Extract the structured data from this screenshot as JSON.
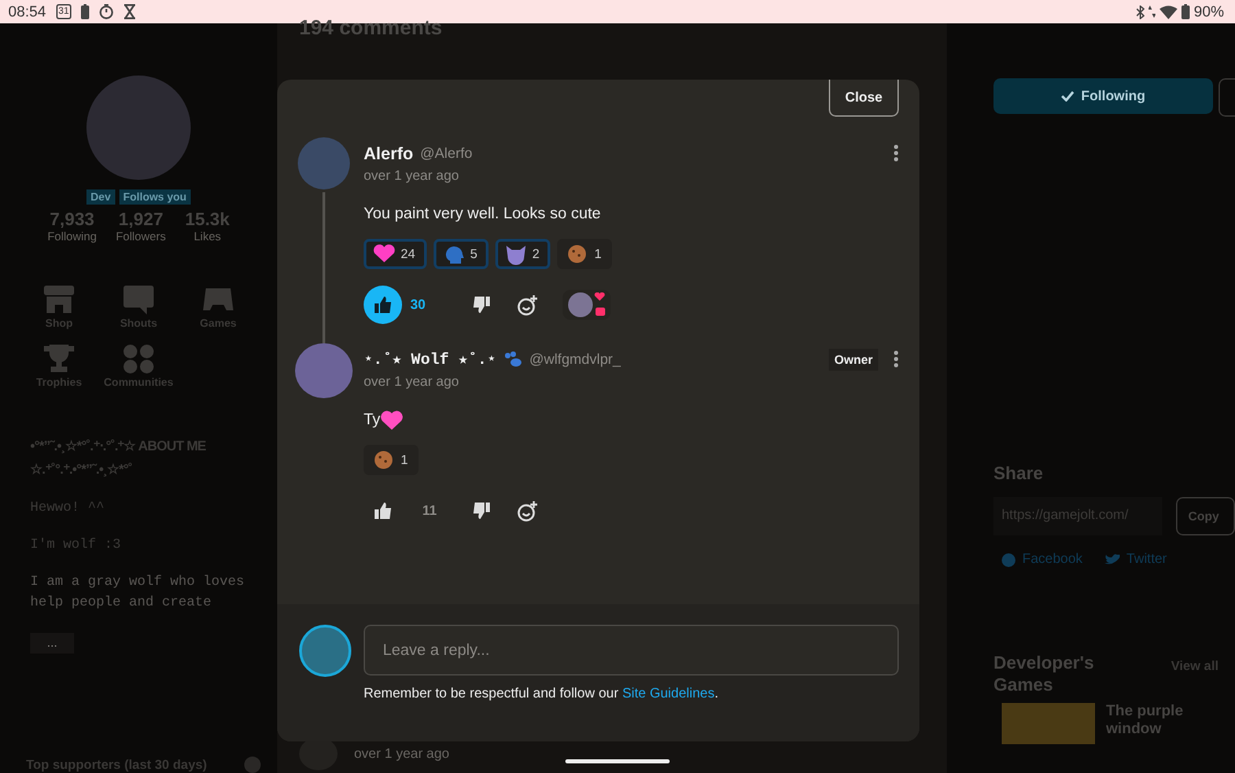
{
  "status_bar": {
    "time": "08:54",
    "calendar_day": "31",
    "battery": "90%"
  },
  "profile": {
    "badges": [
      "Dev",
      "Follows you"
    ],
    "stats": [
      {
        "value": "7,933",
        "label": "Following"
      },
      {
        "value": "1,927",
        "label": "Followers"
      },
      {
        "value": "15.3k",
        "label": "Likes"
      }
    ],
    "nav": [
      {
        "label": "Shop",
        "kind": "shop"
      },
      {
        "label": "Shouts",
        "kind": "shouts"
      },
      {
        "label": "Games",
        "kind": "games"
      },
      {
        "label": "Trophies",
        "kind": "trophies"
      },
      {
        "label": "Communities",
        "kind": "communities"
      }
    ],
    "about_heading": "•°*”˜.•¸☆*°˚.⁺‧.°˚.⁺☆ ABOUT ME ☆.⁺˚°.⁺.•°*”˜.•¸☆*°˚",
    "about_lines": [
      "Hewwo! ^^",
      "I'm wolf :3",
      "I am a gray wolf who loves help people and create"
    ],
    "more_button": "...",
    "supporters_title": "Top supporters (last 30 days)"
  },
  "comments_page": {
    "heading": "194 comments",
    "last_time": "over 1 year ago"
  },
  "sidebar": {
    "follow_button": "Following",
    "share": {
      "title": "Share",
      "url": "https://gamejolt.com/",
      "copy_button": "Copy",
      "links": [
        {
          "label": "Facebook",
          "kind": "facebook"
        },
        {
          "label": "Twitter",
          "kind": "twitter"
        }
      ]
    },
    "dev_games": {
      "title": "Developer's Games",
      "view_all": "View all",
      "games": [
        "The purple window"
      ]
    }
  },
  "modal": {
    "close_button": "Close",
    "comments": [
      {
        "kind": "user",
        "name": "Alerfo",
        "handle": "@Alerfo",
        "time": "over 1 year ago",
        "text": "You paint very well. Looks so cute",
        "text_emoji": false,
        "reactions": [
          {
            "kind": "heart",
            "count": "24",
            "selected": true
          },
          {
            "kind": "silhouette",
            "count": "5",
            "selected": true
          },
          {
            "kind": "wolf",
            "count": "2",
            "selected": true
          },
          {
            "kind": "cookie",
            "count": "1",
            "selected": false
          }
        ],
        "likes": "30",
        "liked": true,
        "owner_liked": true
      },
      {
        "kind": "owner",
        "name": "⋆.˚★ Wolf ★˚.⋆",
        "handle": "@wlfgmdvlpr_",
        "badge": "Owner",
        "time": "over 1 year ago",
        "text": "Ty",
        "text_emoji": true,
        "reactions": [
          {
            "kind": "cookie",
            "count": "1",
            "selected": false
          }
        ],
        "likes": "11",
        "liked": false,
        "owner_liked": false
      }
    ],
    "reply": {
      "placeholder": "Leave a reply...",
      "notice": "Remember to be respectful and follow our",
      "link": "Site Guidelines",
      "notice_end": "."
    }
  }
}
